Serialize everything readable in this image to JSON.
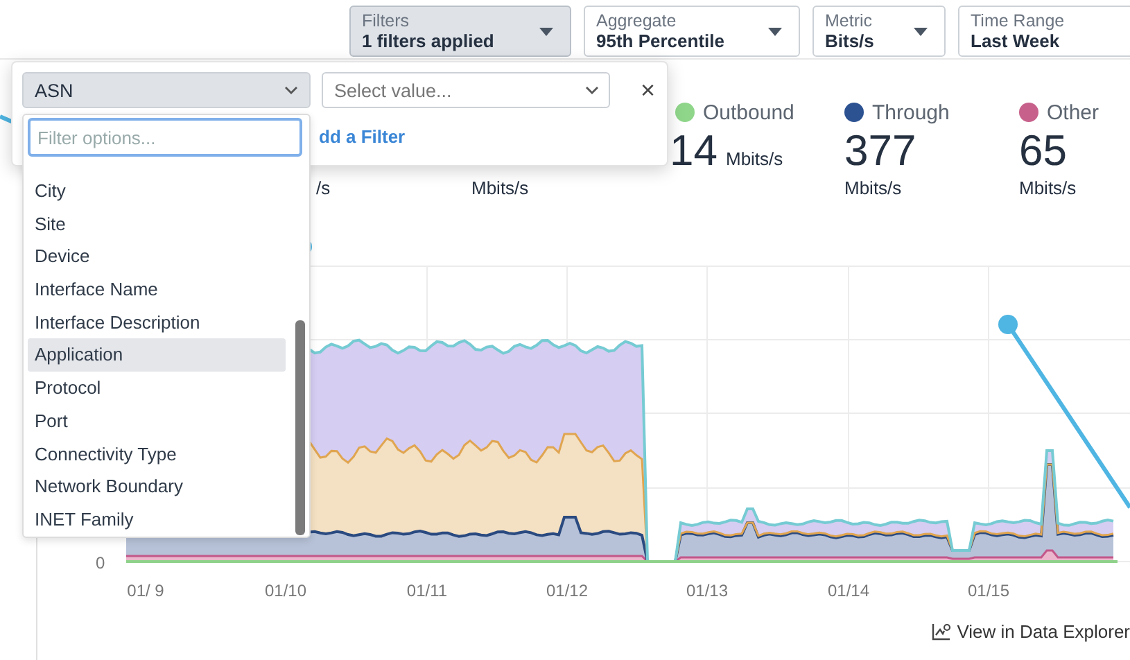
{
  "toolbar": [
    {
      "label": "Filters",
      "value": "1 filters applied",
      "selected": true
    },
    {
      "label": "Aggregate",
      "value": "95th Percentile",
      "selected": false
    },
    {
      "label": "Metric",
      "value": "Bits/s",
      "selected": false
    },
    {
      "label": "Time Range",
      "value": "Last Week",
      "selected": false
    }
  ],
  "filter_popup": {
    "dimension_select": "ASN",
    "value_select": {
      "placeholder": "Select value..."
    },
    "remove": "×",
    "add_link": "dd a Filter"
  },
  "dimension_dropdown": {
    "search": {
      "placeholder": "Filter options..."
    },
    "items": [
      {
        "label": "City",
        "selected": false
      },
      {
        "label": "Site",
        "selected": false
      },
      {
        "label": "Device",
        "selected": false
      },
      {
        "label": "Interface Name",
        "selected": false
      },
      {
        "label": "Interface Description",
        "selected": false
      },
      {
        "label": "Application",
        "selected": true
      },
      {
        "label": "Protocol",
        "selected": false
      },
      {
        "label": "Port",
        "selected": false
      },
      {
        "label": "Connectivity Type",
        "selected": false
      },
      {
        "label": "Network Boundary",
        "selected": false
      },
      {
        "label": "INET Family",
        "selected": false
      }
    ]
  },
  "stats": [
    {
      "unit": "/s"
    },
    {
      "unit": "Mbits/s"
    },
    {
      "label": "Outbound",
      "value": "14",
      "unit": "Mbits/s",
      "color": "#8fd68a",
      "kind": "inline"
    },
    {
      "label": "Through",
      "value": "377",
      "unit": "Mbits/s",
      "color": "#2c5291",
      "kind": "stacked"
    },
    {
      "label": "Other",
      "value": "65",
      "unit": "Mbits/s",
      "color": "#c7618c",
      "kind": "stacked"
    }
  ],
  "chart": {
    "y_zero": "0",
    "x_labels": [
      "01/ 9",
      "01/10",
      "01/11",
      "01/12",
      "01/13",
      "01/14",
      "01/15"
    ]
  },
  "explorer_link": "View in Data Explorer"
}
